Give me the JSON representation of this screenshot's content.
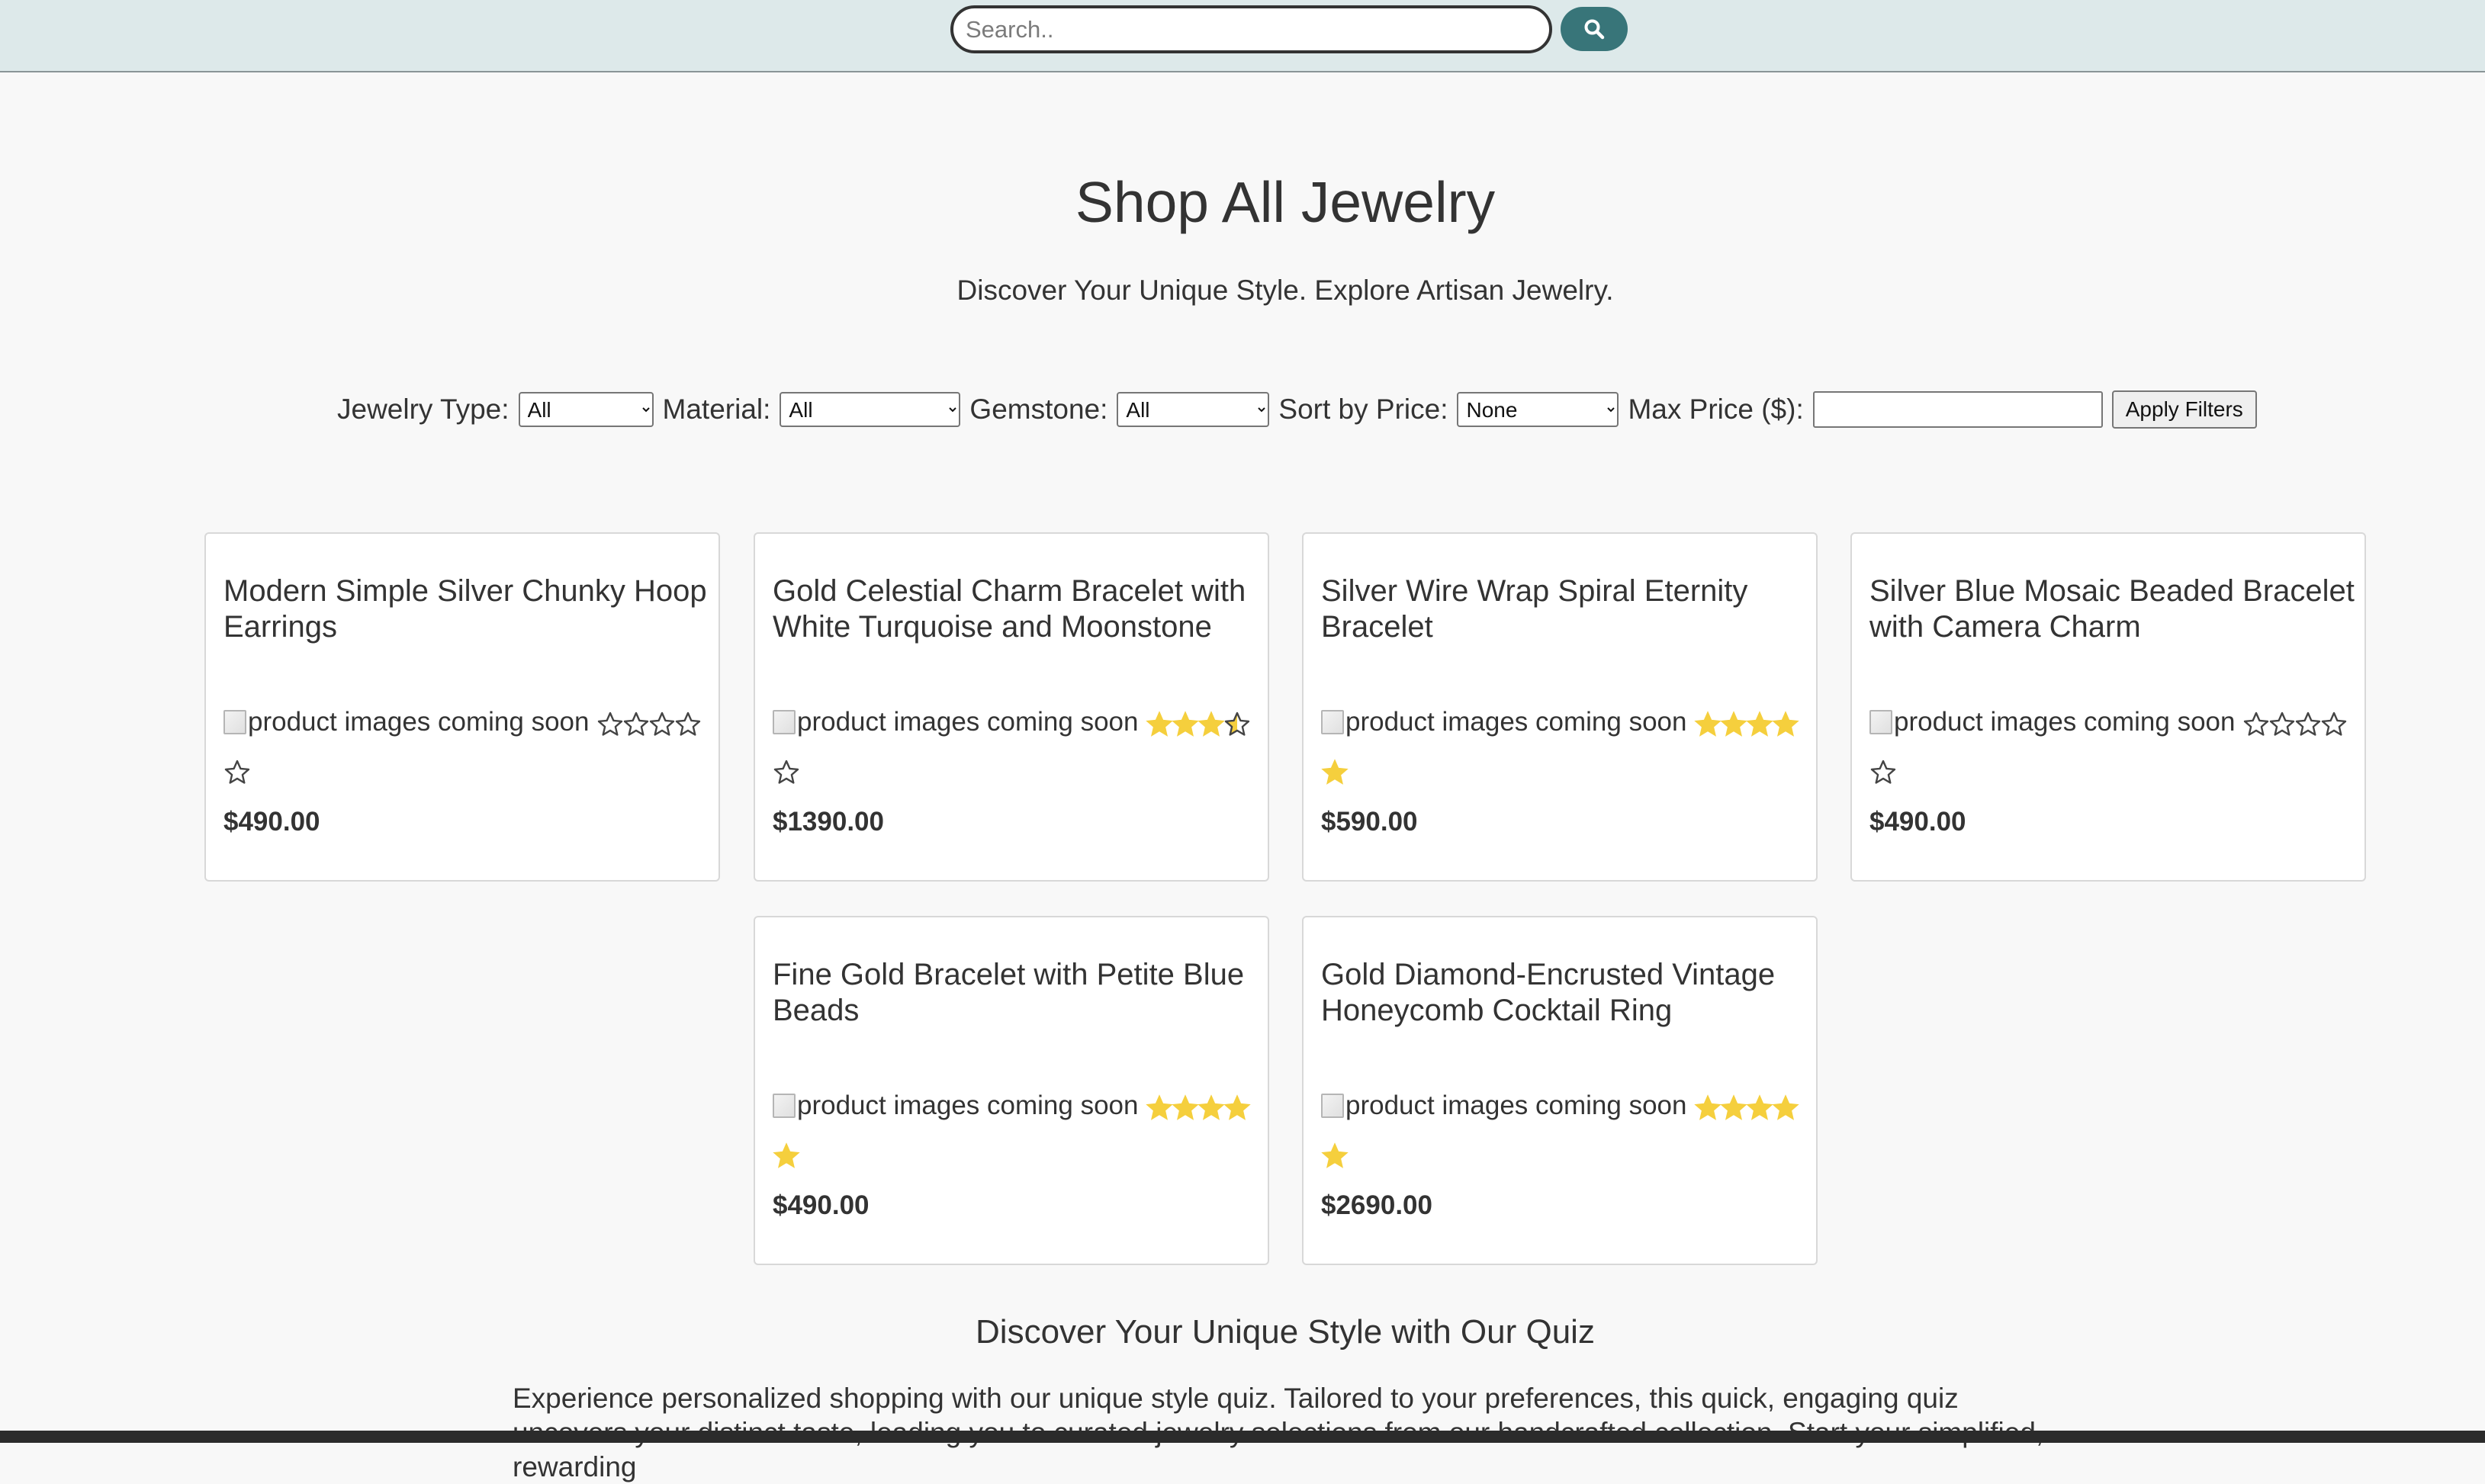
{
  "search": {
    "placeholder": "Search..",
    "button_icon": "search-icon"
  },
  "header": {
    "title": "Shop All Jewelry",
    "subtitle": "Discover Your Unique Style. Explore Artisan Jewelry."
  },
  "filters": {
    "jewelry_type_label": "Jewelry Type:",
    "jewelry_type_value": "All",
    "material_label": "Material:",
    "material_value": "All",
    "gemstone_label": "Gemstone:",
    "gemstone_value": "All",
    "sort_label": "Sort by Price:",
    "sort_value": "None",
    "max_price_label": "Max Price ($):",
    "max_price_value": "",
    "apply_label": "Apply Filters"
  },
  "products": [
    {
      "title": "Modern Simple Silver Chunky Hoop Earrings",
      "image_alt": "product images coming soon",
      "rating": 0,
      "price": "$490.00"
    },
    {
      "title": "Gold Celestial Charm Bracelet with White Turquoise and Moonstone",
      "image_alt": "product images coming soon",
      "rating": 3.5,
      "price": "$1390.00"
    },
    {
      "title": "Silver Wire Wrap Spiral Eternity Bracelet",
      "image_alt": "product images coming soon",
      "rating": 5,
      "price": "$590.00"
    },
    {
      "title": "Silver Blue Mosaic Beaded Bracelet with Camera Charm",
      "image_alt": "product images coming soon",
      "rating": 0,
      "price": "$490.00"
    },
    {
      "title": "Fine Gold Bracelet with Petite Blue Beads",
      "image_alt": "product images coming soon",
      "rating": 5,
      "price": "$490.00"
    },
    {
      "title": "Gold Diamond-Encrusted Vintage Honeycomb Cocktail Ring",
      "image_alt": "product images coming soon",
      "rating": 5,
      "price": "$2690.00"
    }
  ],
  "quiz": {
    "title": "Discover Your Unique Style with Our Quiz",
    "text": "Experience personalized shopping with our unique style quiz. Tailored to your preferences, this quick, engaging quiz uncovers your distinct taste, leading you to curated jewelry selections from our handcrafted collection. Start your simplified, rewarding"
  },
  "colors": {
    "star_fill": "#f5cf3d",
    "star_outline": "#444444",
    "header_bg": "#dde9ea",
    "search_button": "#387579"
  }
}
